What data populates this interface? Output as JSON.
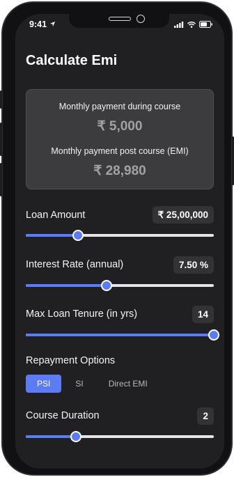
{
  "status": {
    "time": "9:41"
  },
  "title": "Calculate Emi",
  "summary": {
    "during_label": "Monthly payment during course",
    "during_value": "₹ 5,000",
    "post_label": "Monthly payment post course (EMI)",
    "post_value": "₹ 28,980"
  },
  "loan_amount": {
    "label": "Loan Amount",
    "value": "₹ 25,00,000",
    "slider_fraction": 0.277
  },
  "interest_rate": {
    "label": "Interest Rate (annual)",
    "value": "7.50 %",
    "slider_fraction": 0.43
  },
  "tenure": {
    "label": "Max Loan Tenure (in yrs)",
    "value": "14",
    "slider_fraction": 1.0
  },
  "repayment": {
    "label": "Repayment Options",
    "options": [
      "PSI",
      "SI",
      "Direct EMI"
    ],
    "selected": "PSI"
  },
  "course_duration": {
    "label": "Course Duration",
    "value": "2",
    "slider_fraction": 0.267
  },
  "colors": {
    "accent": "#5b7cf5",
    "background": "#202022",
    "card": "#3c3c3e"
  }
}
